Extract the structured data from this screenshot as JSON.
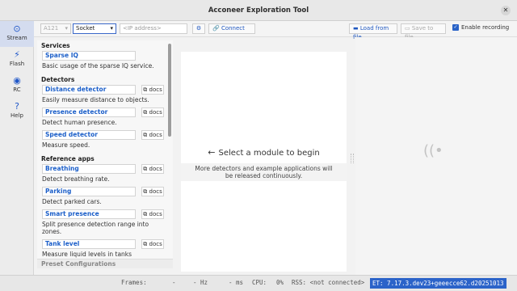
{
  "window": {
    "title": "Acconeer Exploration Tool",
    "close_glyph": "✕"
  },
  "nav": [
    {
      "label": "Stream",
      "icon": "stream-icon",
      "glyph": "⊙"
    },
    {
      "label": "Flash",
      "icon": "flash-icon",
      "glyph": "⚡"
    },
    {
      "label": "RC",
      "icon": "rc-icon",
      "glyph": "◉"
    },
    {
      "label": "Help",
      "icon": "help-icon",
      "glyph": "?"
    }
  ],
  "toolbar": {
    "sensor": "A121",
    "connection": "Socket",
    "ip_placeholder": "<IP address>",
    "connect": "Connect",
    "load": "Load from file",
    "save": "Save to file",
    "recording": "Enable recording"
  },
  "panel": {
    "services_title": "Services",
    "detectors_title": "Detectors",
    "reference_title": "Reference apps",
    "preset_title": "Preset Configurations",
    "docs_label": "docs",
    "services": [
      {
        "name": "Sparse IQ",
        "desc": "Basic usage of the sparse IQ service."
      }
    ],
    "detectors": [
      {
        "name": "Distance detector",
        "desc": "Easily measure distance to objects."
      },
      {
        "name": "Presence detector",
        "desc": "Detect human presence."
      },
      {
        "name": "Speed detector",
        "desc": "Measure speed."
      }
    ],
    "reference": [
      {
        "name": "Breathing",
        "desc": "Detect breathing rate."
      },
      {
        "name": "Parking",
        "desc": "Detect parked cars."
      },
      {
        "name": "Smart presence",
        "desc": "Split presence detection range into zones."
      },
      {
        "name": "Tank level",
        "desc": "Measure liquid levels in tanks"
      }
    ]
  },
  "main": {
    "title": "Select a module to begin",
    "subtitle_1": "More detectors and example applications will",
    "subtitle_2": "be released continuously."
  },
  "status": {
    "frames": "Frames:",
    "frames_val": "-",
    "hz": "- Hz",
    "ms": "- ms",
    "cpu": "CPU:",
    "cpu_val": "0%",
    "rss": "RSS: <not connected>",
    "version": "ET: 7.17.3.dev23+geeecce62.d20251013"
  }
}
